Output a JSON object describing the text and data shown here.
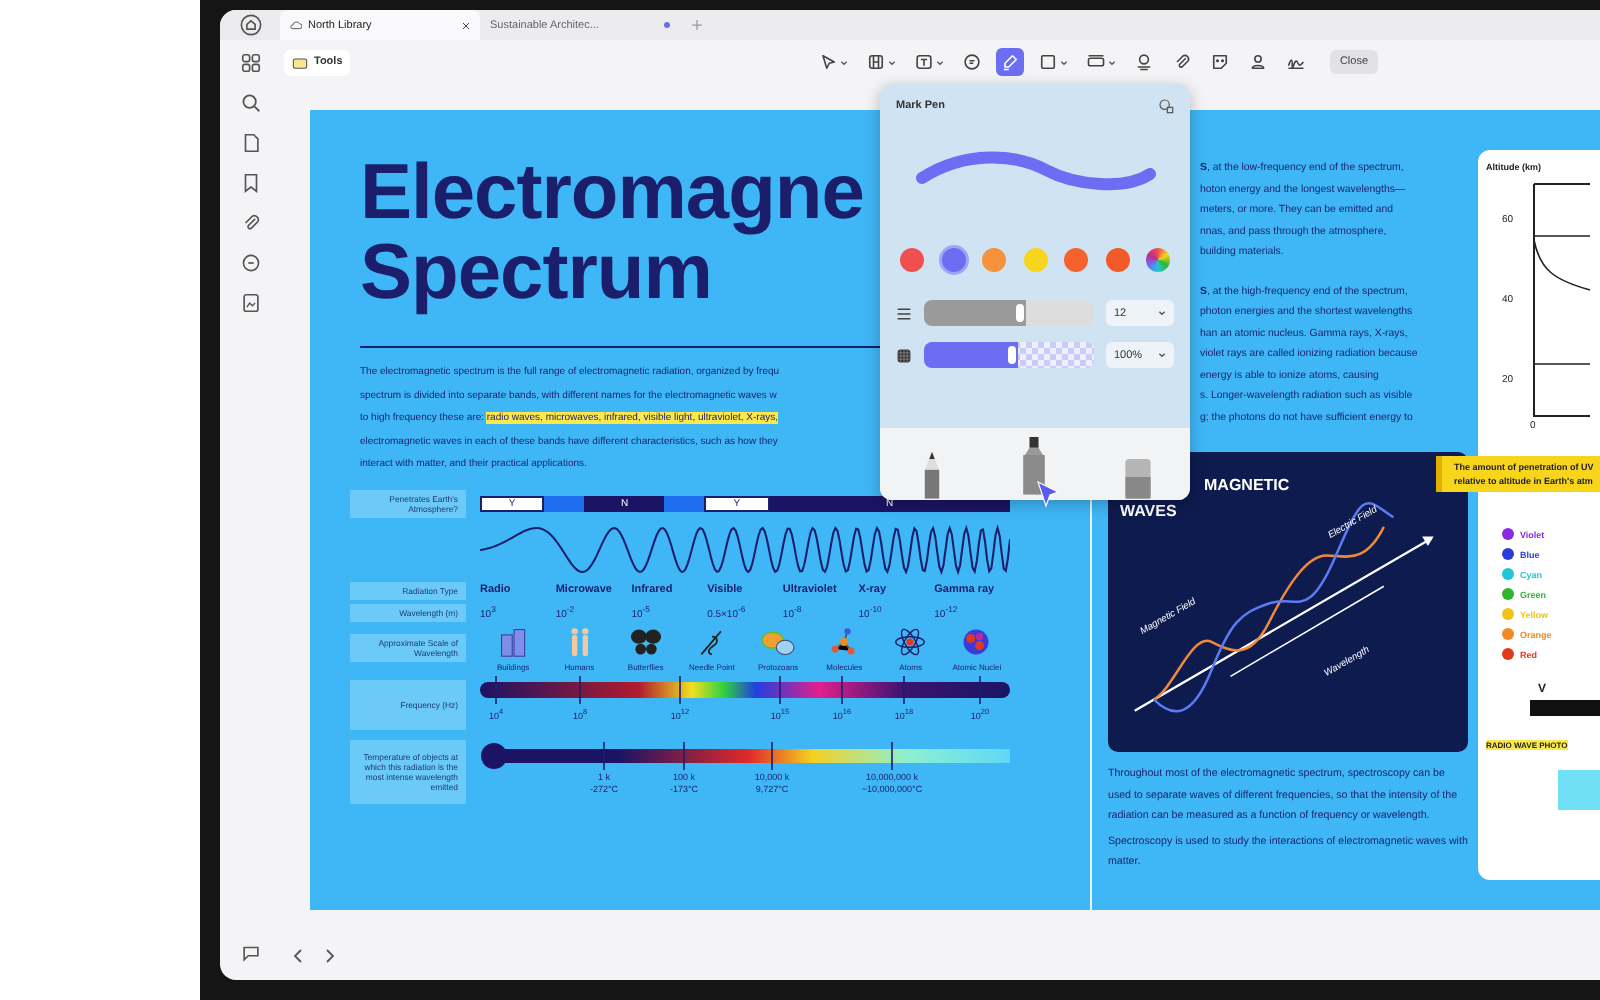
{
  "tabs": [
    {
      "label": "North Library",
      "selected": true,
      "modified": false
    },
    {
      "label": "Sustainable Architec...",
      "selected": false,
      "modified": true
    }
  ],
  "toolbar": {
    "tools_label": "Tools",
    "close_label": "Close",
    "items": [
      {
        "kind": "select",
        "caret": true,
        "selected": false
      },
      {
        "kind": "layout",
        "caret": true,
        "selected": false
      },
      {
        "kind": "textbox",
        "caret": true,
        "selected": false
      },
      {
        "kind": "comment",
        "caret": false,
        "selected": false
      },
      {
        "kind": "pen",
        "caret": false,
        "selected": true
      },
      {
        "kind": "rectangle",
        "caret": true,
        "selected": false
      },
      {
        "kind": "measure",
        "caret": true,
        "selected": false
      },
      {
        "kind": "stamp",
        "caret": false,
        "selected": false
      },
      {
        "kind": "attach",
        "caret": false,
        "selected": false
      },
      {
        "kind": "sticker",
        "caret": false,
        "selected": false
      },
      {
        "kind": "person",
        "caret": false,
        "selected": false
      },
      {
        "kind": "signature",
        "caret": false,
        "selected": false
      }
    ]
  },
  "pen_popup": {
    "title": "Mark Pen",
    "colors": [
      {
        "kind": "swatch",
        "color": "#f04f4f",
        "selected": false
      },
      {
        "kind": "swatch",
        "color": "#6b6ef2",
        "selected": true
      },
      {
        "kind": "swatch",
        "color": "#f5923a",
        "selected": false
      },
      {
        "kind": "swatch",
        "color": "#f7d51d",
        "selected": false
      },
      {
        "kind": "swatch",
        "color": "#f5622e",
        "selected": false
      },
      {
        "kind": "swatch",
        "color": "#f25a2a",
        "selected": false
      },
      {
        "kind": "custom",
        "selected": false
      }
    ],
    "thickness": {
      "level": 0.6,
      "value": "12"
    },
    "opacity": {
      "level": 0.55,
      "value": "100%"
    },
    "tools": [
      {
        "kind": "pencil",
        "selected": false
      },
      {
        "kind": "marker",
        "selected": true
      },
      {
        "kind": "eraser",
        "selected": false
      }
    ]
  },
  "document": {
    "title_lines": [
      "Electromagne",
      "Spectrum"
    ],
    "intro_lines": [
      [
        {
          "text": "The electromagnetic spectrum is the full range of electromagnetic radiation, organized by frequ",
          "highlighted": false
        }
      ],
      [
        {
          "text": "spectrum is divided into separate bands, with different names for the electromagnetic waves w",
          "highlighted": false
        }
      ],
      [
        {
          "text": "to high frequency these are: ",
          "highlighted": false
        },
        {
          "text": "radio waves, microwaves, infrared, visible light, ultraviolet, X-rays,",
          "highlighted": true
        }
      ],
      [
        {
          "text": "electromagnetic waves in each of these bands have different characteristics, such as how they",
          "highlighted": false
        }
      ],
      [
        {
          "text": "interact with matter, and their practical applications.",
          "highlighted": false
        }
      ]
    ],
    "spectrum": {
      "row_labels": {
        "penetrates": "Penetrates Earth's Atmosphere?",
        "type": "Radiation Type",
        "wavelength": "Wavelength (m)",
        "scale": "Approximate Scale of Wavelength",
        "frequency": "Frequency (Hz)",
        "temperature": "Temperature of objects at which this radiation is the most intense wavelength emitted"
      },
      "penetration": [
        {
          "kind": "yes",
          "label": "Y"
        },
        {
          "kind": "gap"
        },
        {
          "kind": "no",
          "label": "N"
        },
        {
          "kind": "gap"
        },
        {
          "kind": "yes",
          "label": "Y"
        },
        {
          "kind": "no",
          "label": "N"
        }
      ],
      "types": [
        {
          "name": "Radio",
          "wavelength": "10$^{3}$"
        },
        {
          "name": "Microwave",
          "wavelength": "10$^{-2}$"
        },
        {
          "name": "Infrared",
          "wavelength": "10$^{-5}$"
        },
        {
          "name": "Visible",
          "wavelength": "0.5×10$^{-6}$"
        },
        {
          "name": "Ultraviolet",
          "wavelength": "10$^{-8}$"
        },
        {
          "name": "X-ray",
          "wavelength": "10$^{-10}$"
        },
        {
          "name": "Gamma ray",
          "wavelength": "10$^{-12}$"
        }
      ],
      "scales": [
        {
          "kind": "buildings",
          "label": "Buildings"
        },
        {
          "kind": "humans",
          "label": "Humans"
        },
        {
          "kind": "butterflies",
          "label": "Butterflies"
        },
        {
          "kind": "needle",
          "label": "Needle Point"
        },
        {
          "kind": "protozoans",
          "label": "Protozoans"
        },
        {
          "kind": "molecules",
          "label": "Molecules"
        },
        {
          "kind": "atoms",
          "label": "Atoms"
        },
        {
          "kind": "nuclei",
          "label": "Atomic Nuclei"
        }
      ],
      "frequencies": [
        "10$^{4}$",
        "10$^{8}$",
        "10$^{12}$",
        "10$^{15}$",
        "10$^{16}$",
        "10$^{18}$",
        "10$^{20}$"
      ],
      "temperatures": [
        {
          "kelvin": "1 k",
          "celsius": "-272°C"
        },
        {
          "kelvin": "100 k",
          "celsius": "-173°C"
        },
        {
          "kelvin": "10,000 k",
          "celsius": "9,727°C"
        },
        {
          "kelvin": "10,000,000 k",
          "celsius": "~10,000,000°C"
        }
      ]
    },
    "right_blocks": [
      [
        "**S**, at the low-frequency end of the spectrum,",
        "hoton energy and the longest wavelengths—",
        "meters, or more. They can be emitted and",
        "nnas, and pass through the atmosphere,",
        " building materials."
      ],
      [
        "**S**, at the high-frequency end of the spectrum,",
        "photon energies and the shortest wavelengths",
        "han an atomic nucleus. Gamma rays, X-rays,",
        "violet rays are called ionizing radiation because",
        " energy is able to ionize atoms, causing",
        "s. Longer-wavelength radiation such as visible",
        "g; the photons do not have sufficient energy to"
      ]
    ],
    "wave_card": {
      "title_lines": [
        "MAGNETIC",
        "WAVES"
      ],
      "electric_label": "Electric Field",
      "magnetic_label": "Magnetic Field",
      "wavelength_label": "Wavelength"
    },
    "closing_paragraphs": [
      "Throughout most of the electromagnetic spectrum, spectroscopy can be used to separate waves of different frequencies, so that the intensity of the radiation can be measured as a function of frequency or wavelength.",
      "Spectroscopy is used to study the interactions of electromagnetic waves with matter."
    ],
    "note_lines": [
      "The amount of penetration of UV",
      "relative to altitude in Earth's atm"
    ],
    "side_panel": {
      "chart_title": "Altitude (km)",
      "y_labels": [
        "60",
        "40",
        "20"
      ],
      "x_label": "0",
      "legend": [
        {
          "name": "Violet",
          "color": "#8a2be2"
        },
        {
          "name": "Blue",
          "color": "#2b3bd9"
        },
        {
          "name": "Cyan",
          "color": "#22c7d6"
        },
        {
          "name": "Green",
          "color": "#2fb52f"
        },
        {
          "name": "Yellow",
          "color": "#f2c21b"
        },
        {
          "name": "Orange",
          "color": "#f08a24"
        },
        {
          "name": "Red",
          "color": "#e03a1e"
        }
      ],
      "marker_label": "V",
      "photo_label": "RADIO WAVE PHOTO"
    }
  }
}
